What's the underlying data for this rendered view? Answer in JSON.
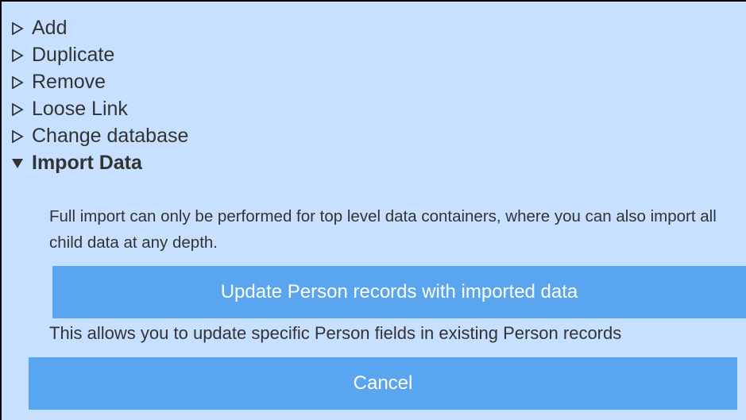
{
  "accordion": {
    "items": [
      {
        "label": "Add",
        "icon": "triangle-right-outline-icon",
        "expanded": false
      },
      {
        "label": "Duplicate",
        "icon": "triangle-right-outline-icon",
        "expanded": false
      },
      {
        "label": "Remove",
        "icon": "triangle-right-outline-icon",
        "expanded": false
      },
      {
        "label": "Loose Link",
        "icon": "triangle-right-outline-icon",
        "expanded": false
      },
      {
        "label": "Change database",
        "icon": "triangle-right-outline-icon",
        "expanded": false
      },
      {
        "label": "Import Data",
        "icon": "triangle-down-filled-icon",
        "expanded": true
      }
    ]
  },
  "import_data": {
    "description": "Full import can only be performed for top level data containers, where you can also import all child data at any depth.",
    "update_button_label": "Update Person records with imported data",
    "update_note": "This allows you to update specific Person fields in existing Person records",
    "cancel_button_label": "Cancel"
  },
  "colors": {
    "panel_background": "#c8e0ff",
    "button_background": "#5aa5f0",
    "button_text": "#ffffff",
    "text": "#333333",
    "border": "#000000"
  }
}
